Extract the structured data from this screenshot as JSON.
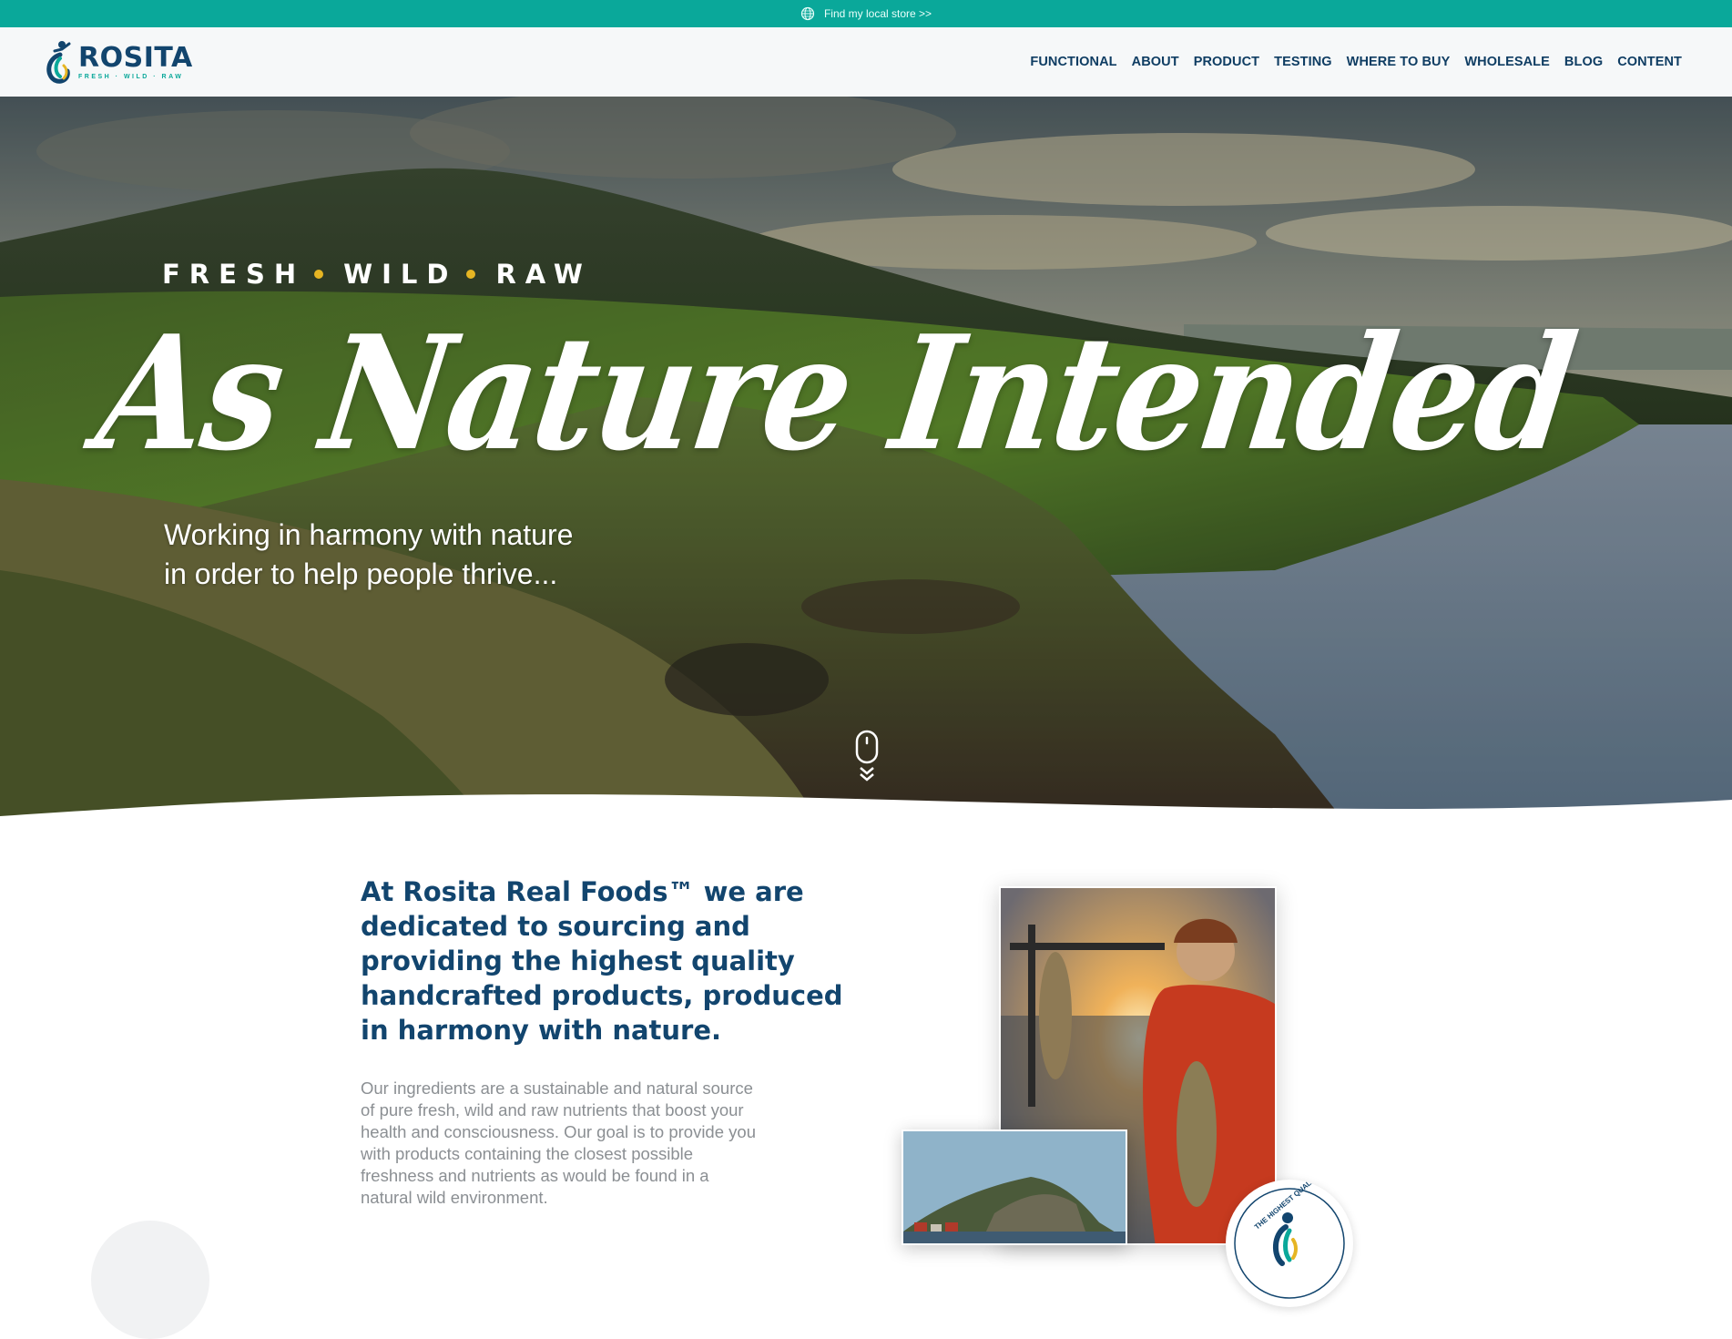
{
  "topbar": {
    "link_label": "Find my local store >>",
    "icon": "globe-icon",
    "bg_color": "#0aa89a"
  },
  "header": {
    "logo_name": "ROSITA",
    "logo_tagline": "FRESH · WILD · RAW",
    "nav": [
      {
        "label": "FUNCTIONAL"
      },
      {
        "label": "ABOUT"
      },
      {
        "label": "PRODUCT"
      },
      {
        "label": "TESTING"
      },
      {
        "label": "WHERE TO BUY"
      },
      {
        "label": "WHOLESALE"
      },
      {
        "label": "BLOG"
      },
      {
        "label": "CONTENT"
      }
    ]
  },
  "hero": {
    "eyebrow": [
      "FRESH",
      "WILD",
      "RAW"
    ],
    "title": "As Nature Intended",
    "subtitle_line1": "Working in harmony with nature",
    "subtitle_line2": "in order to help people thrive...",
    "scroll_icon": "mouse-scroll-icon"
  },
  "intro": {
    "headline": "At Rosita Real Foods™ we are dedicated to sourcing and providing the highest quality handcrafted products, produced in harmony with nature.",
    "body": "Our ingredients are a sustainable and natural source of pure fresh, wild and raw nutrients that boost your health and consciousness. Our goal is to provide you with products containing the closest possible freshness and nutrients as would be found in a natural wild environment.",
    "badge_text": "THE HIGHEST QUALITY"
  },
  "colors": {
    "brand_navy": "#12456e",
    "brand_teal": "#0aa89a",
    "accent_gold": "#e6b523"
  }
}
